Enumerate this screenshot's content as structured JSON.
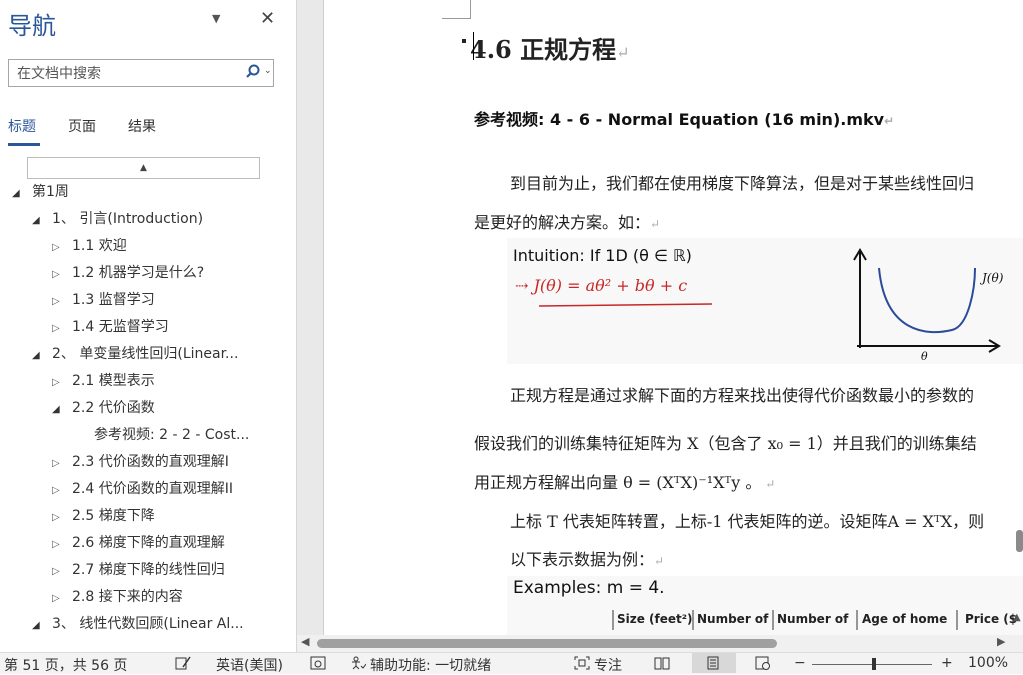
{
  "nav": {
    "title": "导航",
    "search_placeholder": "在文档中搜索",
    "tabs": [
      "标题",
      "页面",
      "结果"
    ],
    "scroll_up": "▲",
    "tree": [
      {
        "label": "第1周",
        "level": 0,
        "state": "open"
      },
      {
        "label": "1、 引言(Introduction)",
        "level": 1,
        "state": "open"
      },
      {
        "label": "1.1 欢迎",
        "level": 2,
        "state": "closed"
      },
      {
        "label": "1.2 机器学习是什么?",
        "level": 2,
        "state": "closed"
      },
      {
        "label": "1.3 监督学习",
        "level": 2,
        "state": "closed"
      },
      {
        "label": "1.4 无监督学习",
        "level": 2,
        "state": "closed"
      },
      {
        "label": "2、 单变量线性回归(Linear...",
        "level": 1,
        "state": "open"
      },
      {
        "label": "2.1 模型表示",
        "level": 2,
        "state": "closed"
      },
      {
        "label": "2.2 代价函数",
        "level": 2,
        "state": "open"
      },
      {
        "label": "参考视频: 2 - 2 - Cost...",
        "level": 3,
        "state": "none"
      },
      {
        "label": "2.3 代价函数的直观理解I",
        "level": 2,
        "state": "closed"
      },
      {
        "label": "2.4 代价函数的直观理解II",
        "level": 2,
        "state": "closed"
      },
      {
        "label": "2.5 梯度下降",
        "level": 2,
        "state": "closed"
      },
      {
        "label": "2.6 梯度下降的直观理解",
        "level": 2,
        "state": "closed"
      },
      {
        "label": "2.7 梯度下降的线性回归",
        "level": 2,
        "state": "closed"
      },
      {
        "label": "2.8 接下来的内容",
        "level": 2,
        "state": "closed"
      },
      {
        "label": "3、 线性代数回顾(Linear Al...",
        "level": 1,
        "state": "open"
      }
    ]
  },
  "doc": {
    "heading": "4.6  正规方程",
    "subheading": "参考视频: 4 - 6 - Normal Equation (16 min).mkv",
    "paragraphs": [
      "到目前为止，我们都在使用梯度下降算法，但是对于某些线性回归",
      "是更好的解决方案。如：",
      "正规方程是通过求解下面的方程来找出使得代价函数最小的参数的",
      "假设我们的训练集特征矩阵为 X（包含了 x₀ = 1）并且我们的训练集结",
      "用正规方程解出向量 θ = (XᵀX)⁻¹Xᵀy 。",
      "上标 T 代表矩阵转置，上标-1 代表矩阵的逆。设矩阵A = XᵀX，则",
      "以下表示数据为例："
    ],
    "figure": {
      "line1": "Intuition: If 1D (θ ∈ ℝ)",
      "line2": "J(θ) = aθ² + bθ + c",
      "curve_label": "J(θ)",
      "axis_label": "θ"
    },
    "examples": {
      "title": "Examples: m = 4.",
      "columns": [
        "Size (feet²)",
        "Number of",
        "Number of",
        "Age of home",
        "Price ($"
      ]
    }
  },
  "status": {
    "page": "第 51 页，共 56 页",
    "language": "英语(美国)",
    "accessibility": "辅助功能: 一切就绪",
    "focus": "专注",
    "zoom": "100%",
    "minus": "−",
    "plus": "+"
  },
  "colors": {
    "accent": "#2b579a",
    "red": "#c62828"
  }
}
